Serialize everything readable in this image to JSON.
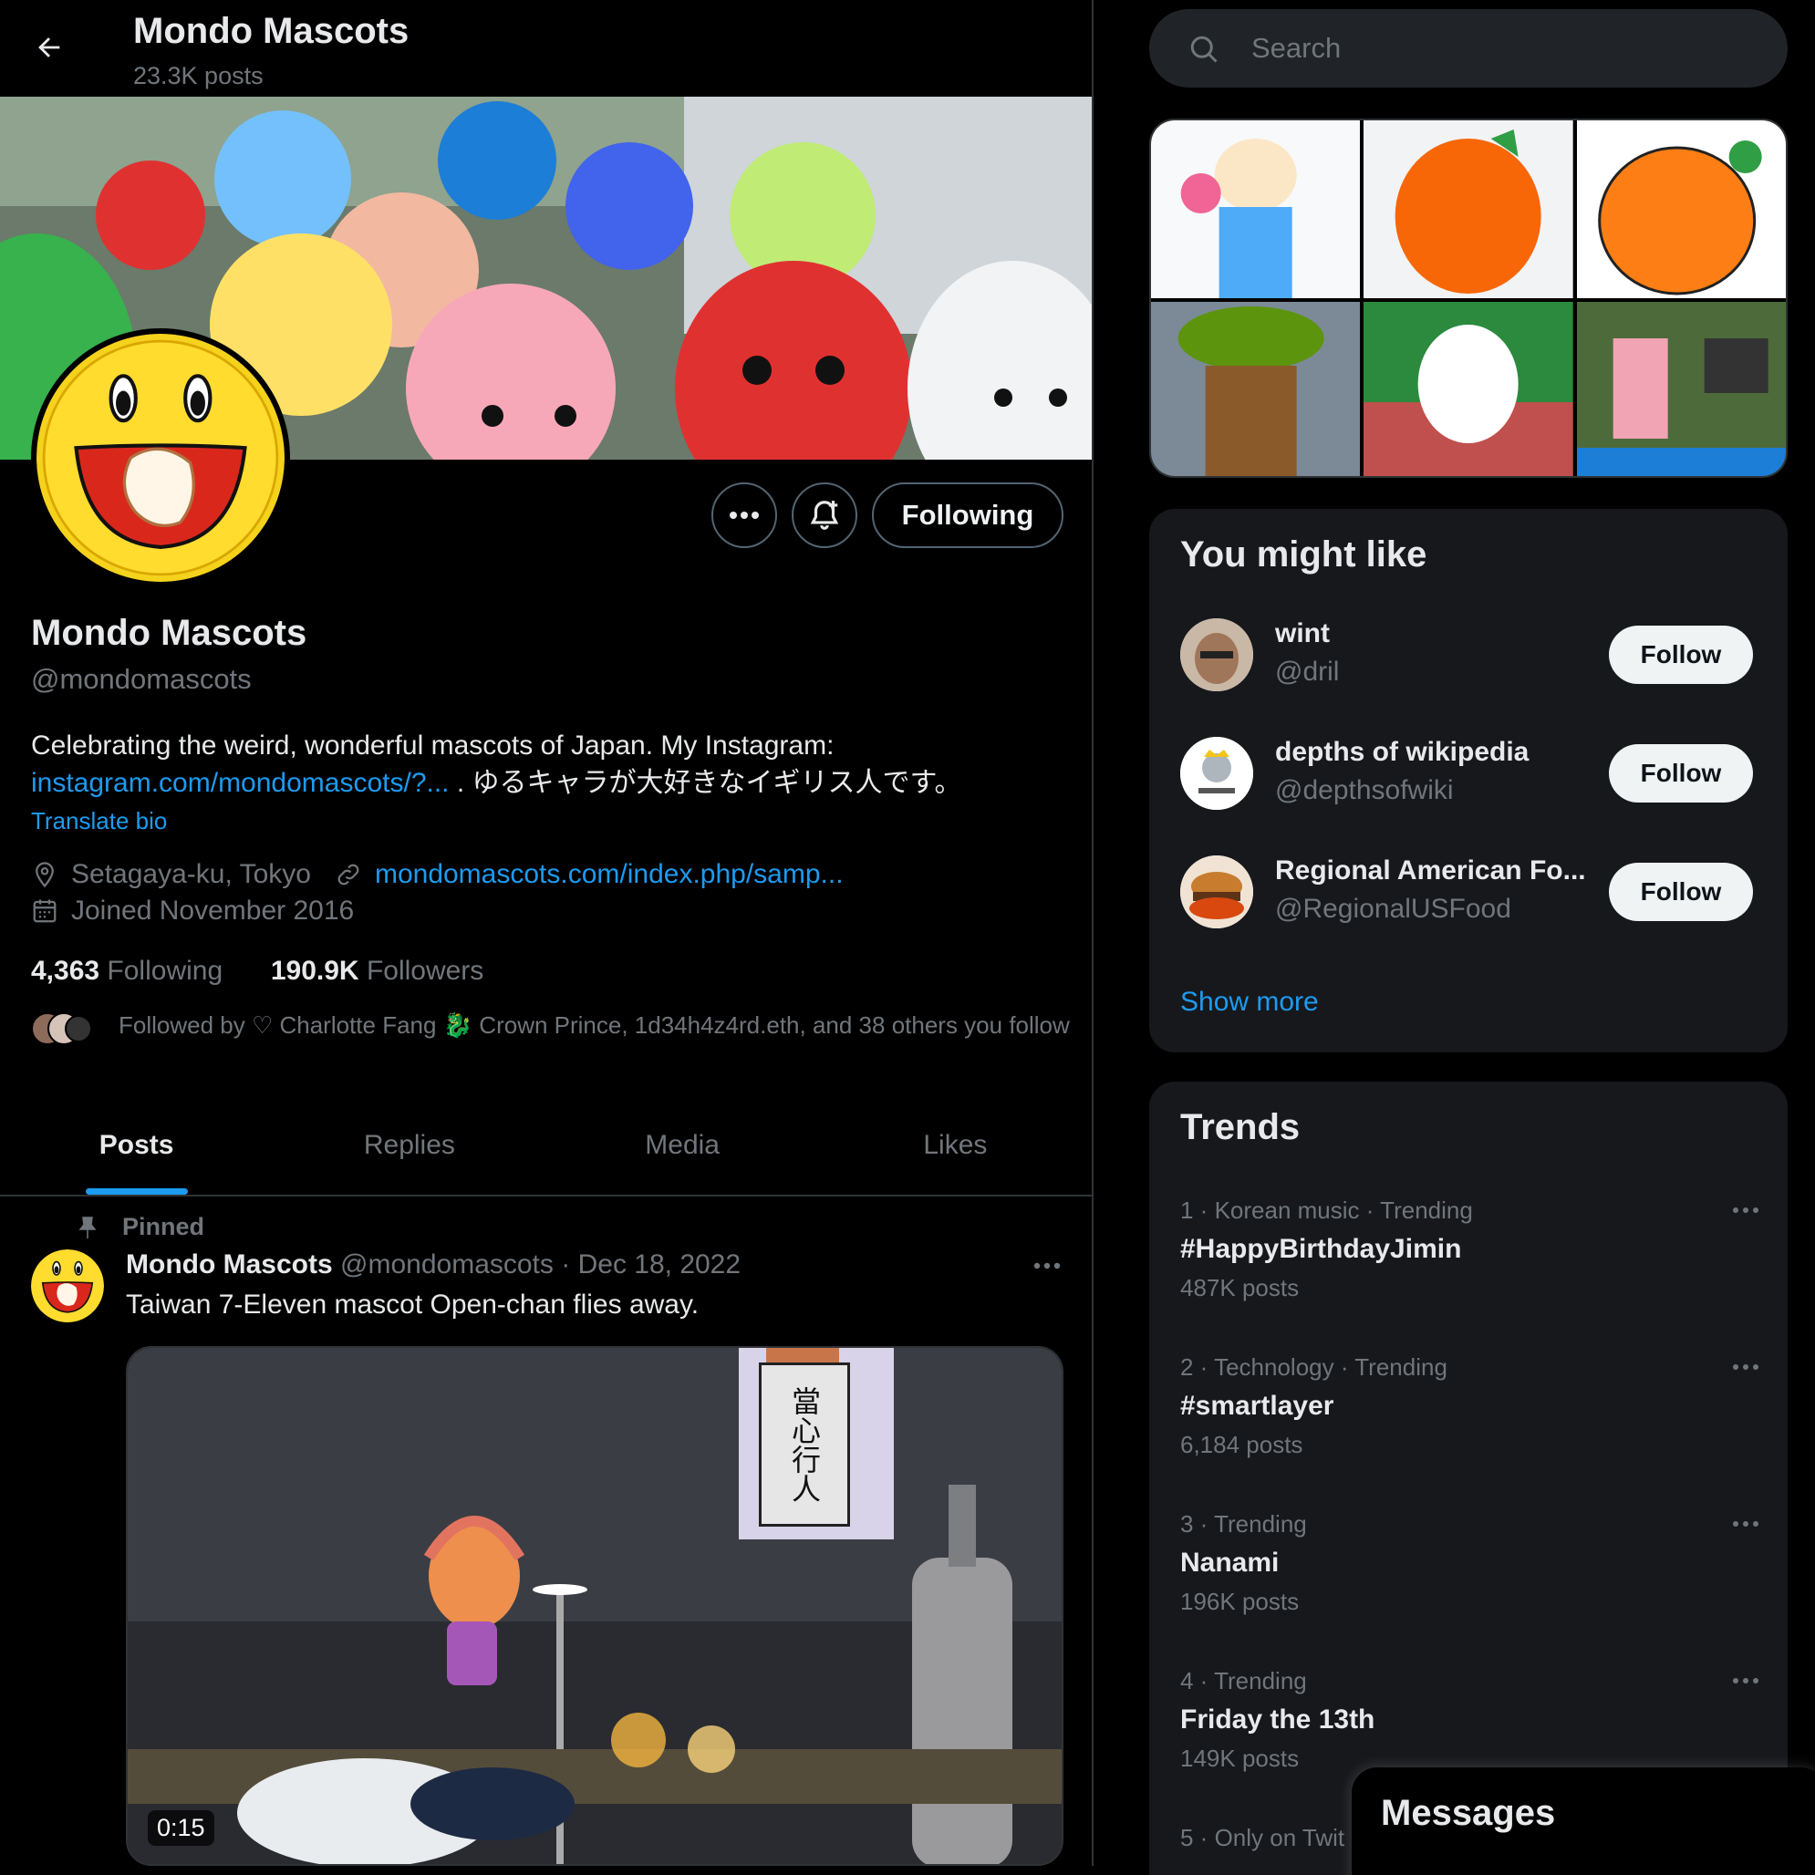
{
  "header": {
    "title": "Mondo Mascots",
    "post_count": "23.3K posts"
  },
  "profile": {
    "name": "Mondo Mascots",
    "handle": "@mondomascots",
    "bio_text": "Celebrating the weird, wonderful mascots of Japan. My Instagram:",
    "bio_link": "instagram.com/mondomascots/?...",
    "bio_suffix": " . ゆるキャラが大好きなイギリス人です。",
    "translate": "Translate bio",
    "location": "Setagaya-ku, Tokyo",
    "website": "mondomascots.com/index.php/samp...",
    "joined": "Joined November 2016",
    "following_count": "4,363",
    "following_label": "Following",
    "followers_count": "190.9K",
    "followers_label": "Followers",
    "followed_by": "Followed by ♡ Charlotte Fang 🐉 Crown Prince, 1d34h4z4rd.eth, and 38 others you follow",
    "following_button": "Following"
  },
  "tabs": [
    "Posts",
    "Replies",
    "Media",
    "Likes"
  ],
  "active_tab": "Posts",
  "pinned_post": {
    "pinned_label": "Pinned",
    "author": "Mondo Mascots",
    "handle": "@mondomascots",
    "date": "Dec 18, 2022",
    "text": "Taiwan 7-Eleven mascot Open-chan flies away.",
    "video_duration": "0:15",
    "sign_text": "當心行人"
  },
  "sidebar": {
    "search_placeholder": "Search",
    "you_might_like": {
      "title": "You might like",
      "accounts": [
        {
          "name": "wint",
          "handle": "@dril",
          "button": "Follow"
        },
        {
          "name": "depths of wikipedia",
          "handle": "@depthsofwiki",
          "button": "Follow"
        },
        {
          "name": "Regional American Fo...",
          "handle": "@RegionalUSFood",
          "button": "Follow"
        }
      ],
      "show_more": "Show more"
    },
    "trends": {
      "title": "Trends",
      "items": [
        {
          "context": "1 · Korean music · Trending",
          "topic": "#HappyBirthdayJimin",
          "posts": "487K posts"
        },
        {
          "context": "2 · Technology · Trending",
          "topic": "#smartlayer",
          "posts": "6,184 posts"
        },
        {
          "context": "3 · Trending",
          "topic": "Nanami",
          "posts": "196K posts"
        },
        {
          "context": "4 · Trending",
          "topic": "Friday the 13th",
          "posts": "149K posts"
        },
        {
          "context": "5 · Only on Twit"
        }
      ]
    },
    "messages": "Messages"
  },
  "colors": {
    "accent": "#1d9bf0",
    "background": "#000000",
    "card": "#16181c",
    "muted": "#71767b"
  },
  "icons": [
    "back-arrow-icon",
    "more-icon",
    "bell-plus-icon",
    "location-icon",
    "link-icon",
    "calendar-icon",
    "pin-icon",
    "search-icon"
  ]
}
